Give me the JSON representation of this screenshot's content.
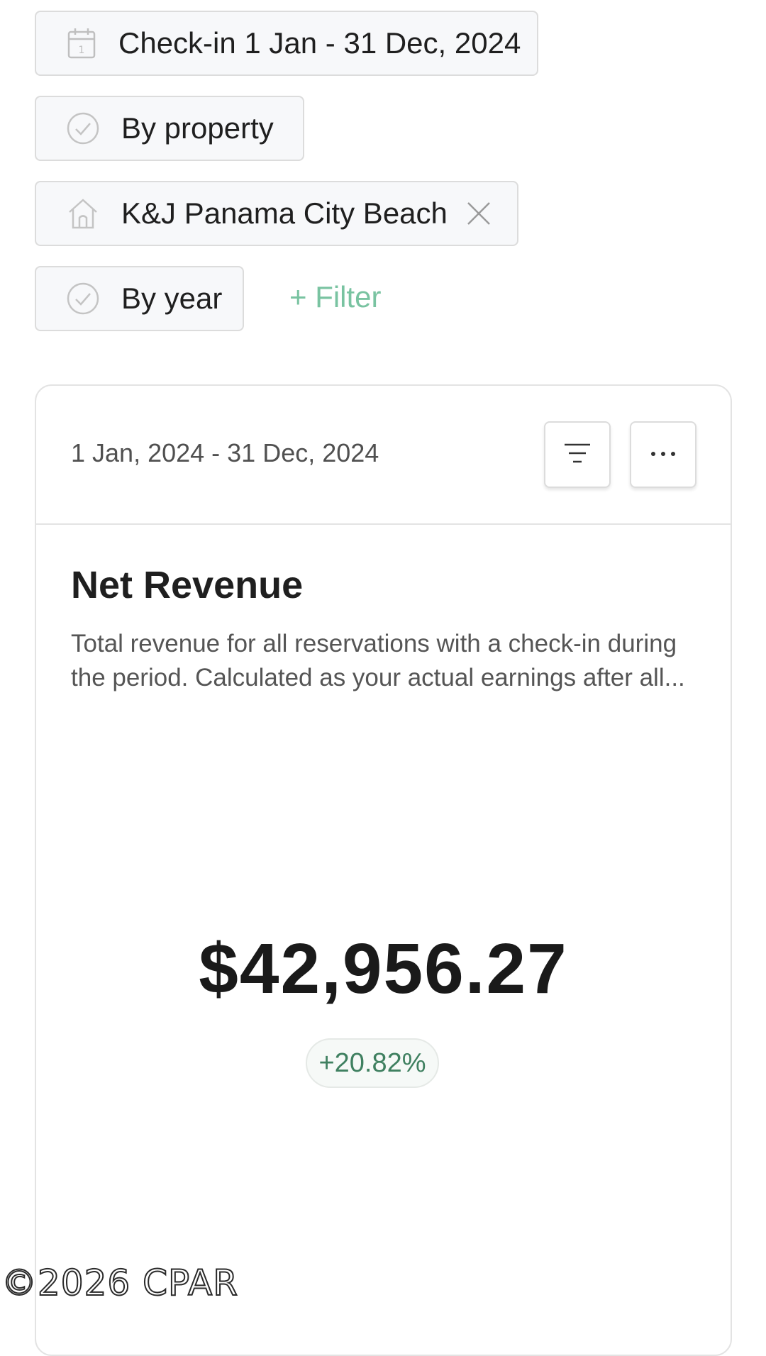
{
  "filters": {
    "date_range": {
      "label": "Check-in 1 Jan - 31 Dec, 2024",
      "icon": "calendar-icon"
    },
    "group_by_property": {
      "label": "By property",
      "icon": "check-circle-icon"
    },
    "property": {
      "label": "K&J Panama City Beach",
      "icon": "home-icon",
      "clear_icon": "close-icon"
    },
    "group_by_year": {
      "label": "By year",
      "icon": "check-circle-icon"
    },
    "add_filter": "+ Filter"
  },
  "card": {
    "date_range": "1 Jan, 2024 - 31 Dec, 2024",
    "actions": {
      "sort_icon": "sort-icon",
      "more_icon": "more-horizontal-icon"
    },
    "metric": {
      "title": "Net Revenue",
      "description": "Total revenue for all reservations with a check-in during the period. Calculated as your actual earnings after all...",
      "value": "$42,956.27",
      "change": "+20.82%"
    }
  },
  "watermark": "©2026 CPAR",
  "colors": {
    "accent": "#79c3a1",
    "positive": "#3f8060",
    "border": "#dcdcdc",
    "chip_bg": "#f7f8fa"
  }
}
